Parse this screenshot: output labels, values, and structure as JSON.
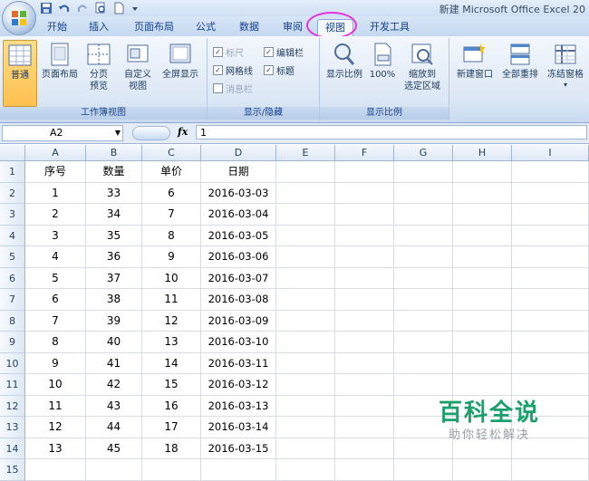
{
  "window": {
    "title": "新建 Microsoft Office Excel 20"
  },
  "tabs": [
    {
      "label": "开始",
      "active": false
    },
    {
      "label": "插入",
      "active": false
    },
    {
      "label": "页面布局",
      "active": false
    },
    {
      "label": "公式",
      "active": false
    },
    {
      "label": "数据",
      "active": false
    },
    {
      "label": "审阅",
      "active": false
    },
    {
      "label": "视图",
      "active": true
    },
    {
      "label": "开发工具",
      "active": false
    }
  ],
  "ribbon": {
    "workbook_views": {
      "label": "工作簿视图",
      "normal": "普通",
      "page_layout": "页面布局",
      "page_break_1": "分页",
      "page_break_2": "预览",
      "custom_1": "自定义",
      "custom_2": "视图",
      "fullscreen": "全屏显示"
    },
    "show_hide": {
      "label": "显示/隐藏",
      "ruler": "标尺",
      "formula_bar": "编辑栏",
      "gridlines": "网格线",
      "headings": "标题",
      "message_bar": "消息栏",
      "ruler_checked": true,
      "formula_bar_checked": true,
      "gridlines_checked": true,
      "headings_checked": true,
      "message_bar_checked": false
    },
    "zoom": {
      "label": "显示比例",
      "zoom": "显示比例",
      "hundred": "100%",
      "fit_1": "缩放到",
      "fit_2": "选定区域"
    },
    "window": {
      "new_window": "新建窗口",
      "arrange_all": "全部重排",
      "freeze": "冻结窗格",
      "freeze_arrow": "▾"
    }
  },
  "formula_bar": {
    "name_box": "A2",
    "fx": "fx",
    "value": "1"
  },
  "sheet": {
    "columns": [
      "A",
      "B",
      "C",
      "D",
      "E",
      "F",
      "G",
      "H",
      "I"
    ],
    "row_numbers": [
      "1",
      "2",
      "3",
      "4",
      "5",
      "6",
      "7",
      "8",
      "9",
      "10",
      "11",
      "12",
      "13",
      "14",
      "15"
    ],
    "header": [
      "序号",
      "数量",
      "单价",
      "日期"
    ],
    "rows": [
      [
        "1",
        "33",
        "6",
        "2016-03-03"
      ],
      [
        "2",
        "34",
        "7",
        "2016-03-04"
      ],
      [
        "3",
        "35",
        "8",
        "2016-03-05"
      ],
      [
        "4",
        "36",
        "9",
        "2016-03-06"
      ],
      [
        "5",
        "37",
        "10",
        "2016-03-07"
      ],
      [
        "6",
        "38",
        "11",
        "2016-03-08"
      ],
      [
        "7",
        "39",
        "12",
        "2016-03-09"
      ],
      [
        "8",
        "40",
        "13",
        "2016-03-10"
      ],
      [
        "9",
        "41",
        "14",
        "2016-03-11"
      ],
      [
        "10",
        "42",
        "15",
        "2016-03-12"
      ],
      [
        "11",
        "43",
        "16",
        "2016-03-13"
      ],
      [
        "12",
        "44",
        "17",
        "2016-03-14"
      ],
      [
        "13",
        "45",
        "18",
        "2016-03-15"
      ]
    ]
  },
  "watermark": {
    "main": "百科全说",
    "sub": "助你轻松解决"
  },
  "colors": {
    "accent": "#15428b",
    "highlight_ring": "#e531e0",
    "watermark": "#1aa06a"
  }
}
